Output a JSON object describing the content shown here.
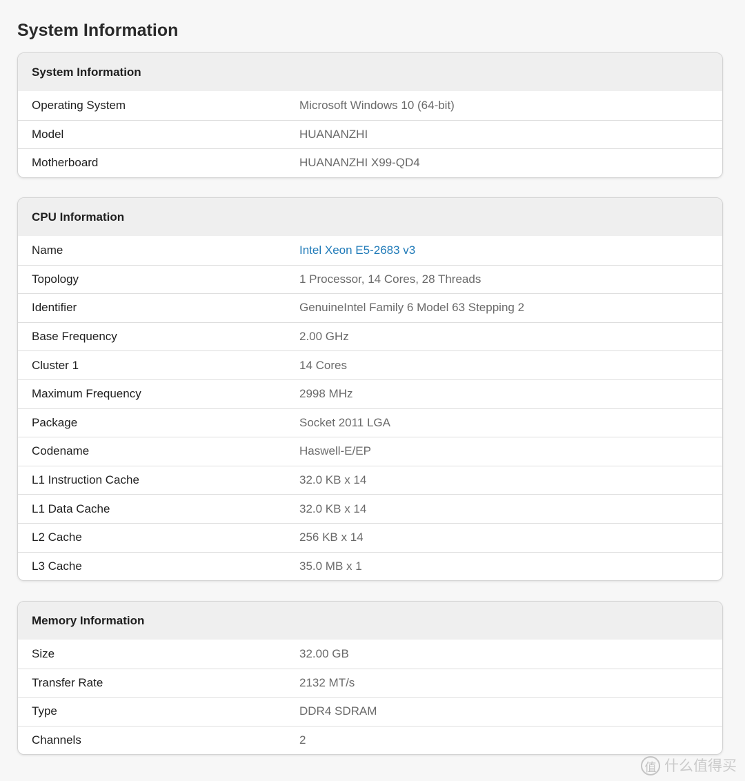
{
  "page": {
    "title": "System Information"
  },
  "panels": {
    "system": {
      "title": "System Information",
      "rows": [
        {
          "label": "Operating System",
          "value": "Microsoft Windows 10 (64-bit)"
        },
        {
          "label": "Model",
          "value": "HUANANZHI"
        },
        {
          "label": "Motherboard",
          "value": "HUANANZHI X99-QD4"
        }
      ]
    },
    "cpu": {
      "title": "CPU Information",
      "rows": [
        {
          "label": "Name",
          "value": "Intel Xeon E5-2683 v3"
        },
        {
          "label": "Topology",
          "value": "1 Processor, 14 Cores, 28 Threads"
        },
        {
          "label": "Identifier",
          "value": "GenuineIntel Family 6 Model 63 Stepping 2"
        },
        {
          "label": "Base Frequency",
          "value": "2.00 GHz"
        },
        {
          "label": "Cluster 1",
          "value": "14 Cores"
        },
        {
          "label": "Maximum Frequency",
          "value": "2998 MHz"
        },
        {
          "label": "Package",
          "value": "Socket 2011 LGA"
        },
        {
          "label": "Codename",
          "value": "Haswell-E/EP"
        },
        {
          "label": "L1 Instruction Cache",
          "value": "32.0 KB x 14"
        },
        {
          "label": "L1 Data Cache",
          "value": "32.0 KB x 14"
        },
        {
          "label": "L2 Cache",
          "value": "256 KB x 14"
        },
        {
          "label": "L3 Cache",
          "value": "35.0 MB x 1"
        }
      ]
    },
    "memory": {
      "title": "Memory Information",
      "rows": [
        {
          "label": "Size",
          "value": "32.00 GB"
        },
        {
          "label": "Transfer Rate",
          "value": "2132 MT/s"
        },
        {
          "label": "Type",
          "value": "DDR4 SDRAM"
        },
        {
          "label": "Channels",
          "value": "2"
        }
      ]
    }
  },
  "watermark": {
    "logo_glyph": "值",
    "text": "什么值得买"
  },
  "colors": {
    "link": "#1f7ab8",
    "header_bg": "#efefef",
    "value_text": "#6a6a6a"
  }
}
